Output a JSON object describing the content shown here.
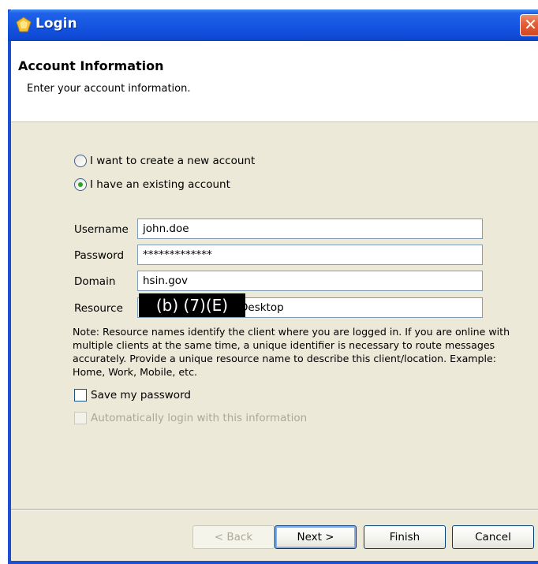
{
  "window": {
    "title": "Login",
    "close_label": "✕"
  },
  "header": {
    "title": "Account Information",
    "subtitle": "Enter your account information."
  },
  "account_type": {
    "options": [
      {
        "label": "I want to create a new account",
        "selected": false
      },
      {
        "label": "I have an existing account",
        "selected": true
      }
    ]
  },
  "form": {
    "username": {
      "label": "Username",
      "value": "john.doe"
    },
    "password": {
      "label": "Password",
      "value": "*************"
    },
    "domain": {
      "label": "Domain",
      "value": "hsin.gov"
    },
    "resource": {
      "label": "Resource",
      "value": "Desktop",
      "redaction_label": "(b) (7)(E)"
    }
  },
  "note": "Note: Resource names identify the client where you are logged in.  If you are online with multiple clients at the same time, a unique identifier is necessary to route messages accurately.  Provide a unique resource name to describe this client/location. Example: Home, Work, Mobile, etc.",
  "options": {
    "save_password": {
      "label": "Save my password",
      "checked": false
    },
    "auto_login": {
      "label": "Automatically login with this information",
      "checked": false,
      "enabled": false
    }
  },
  "buttons": {
    "back": "< Back",
    "next": "Next >",
    "finish": "Finish",
    "cancel": "Cancel"
  },
  "colors": {
    "titlebar": "#1554e0",
    "dialog_background": "#ece9d8",
    "radio_selected": "#29a329"
  }
}
